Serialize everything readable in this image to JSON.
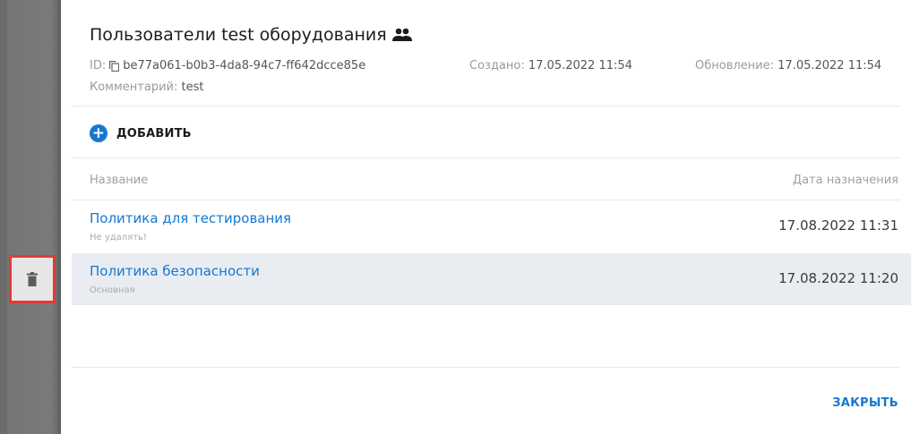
{
  "sidebar": {
    "delete_icon": "trash-icon"
  },
  "dialog": {
    "title": "Пользователи test оборудования",
    "title_icon": "group-icon",
    "id_label": "ID:",
    "id_value": "be77a061-b0b3-4da8-94c7-ff642dcce85e",
    "created_label": "Создано:",
    "created_value": "17.05.2022 11:54",
    "updated_label": "Обновление:",
    "updated_value": "17.05.2022 11:54",
    "comment_label": "Комментарий:",
    "comment_value": "test",
    "add_label": "ДОБАВИТЬ",
    "columns": {
      "name": "Название",
      "date": "Дата назначения"
    },
    "rows": [
      {
        "name": "Политика для тестирования",
        "comment": "Не удалять!",
        "date": "17.08.2022 11:31"
      },
      {
        "name": "Политика безопасности",
        "comment": "Основная",
        "date": "17.08.2022 11:20"
      }
    ],
    "close_label": "ЗАКРЫТЬ"
  },
  "colors": {
    "accent": "#1677d2",
    "highlight_row": "#e9edf1",
    "delete_outline": "#e53935"
  }
}
